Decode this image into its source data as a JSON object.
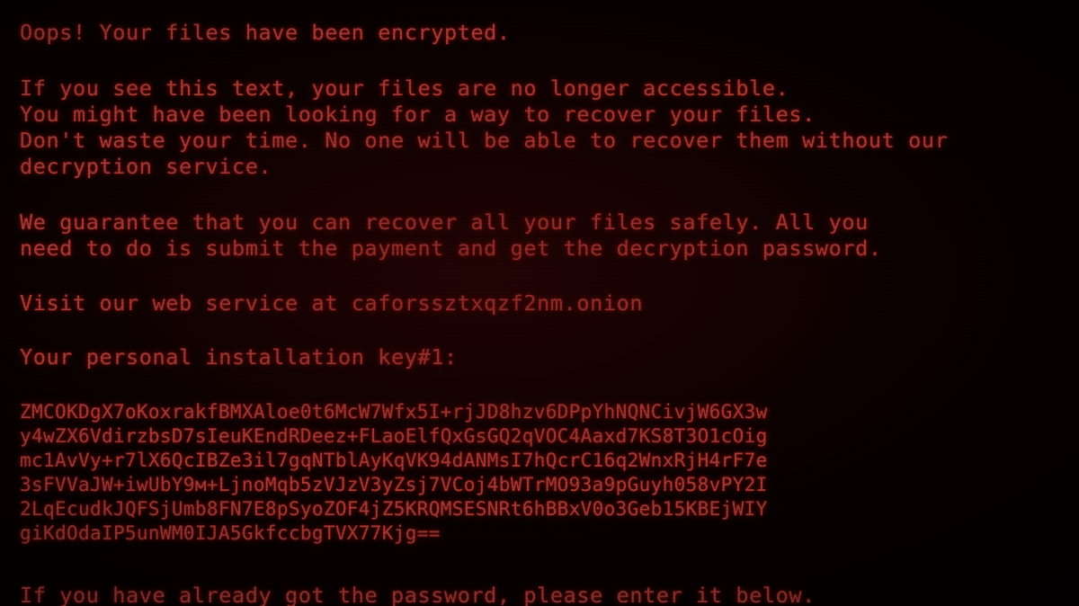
{
  "screen": {
    "kind": "ransomware-lock-screen",
    "background_color": "#000000",
    "text_color": "#e8564e",
    "glow_color": "#b81f18"
  },
  "message": {
    "headline": "Oops! Your files have been encrypted.",
    "paragraph1": [
      "If you see this text, your files are no longer accessible.",
      "You might have been looking for a way to recover your files.",
      "Don't waste your time. No one will be able to recover them without our",
      "decryption service."
    ],
    "paragraph2": [
      "We guarantee that you can recover all your files safely. All you",
      "need to do is submit the payment and get the decryption password."
    ],
    "web_service_line": "Visit our web service at caforssztxqzf2nm.onion",
    "key_label": "Your personal installation key#1:",
    "key_lines": [
      "ZMCOKDgX7oKoxrakfBMXAloe0t6McW7Wfx5I+rjJD8hzv6DPpYhNQNCivjW6GX3w",
      "y4wZX6VdirzbsD7sIeuKEndRDeez+FLaoElfQxGsGQ2qVOC4Aaxd7KS8T3O1cOig",
      "mc1AvVy+r7lX6QcIBZe3il7gqNTblAyKqVK94dANMsI7hQcrC16q2WnxRjH4rF7e",
      "3sFVVaJW+iwUbY9м+LjnoMqb5zVJzV3yZsj7VCoj4bWTrMO93a9pGuyh058vPY2I",
      "2LqEcudkJQFSjUmb8FN7E8pSyoZOF4jZ5KRQMSESNRt6hBBxV0o3Geb15KBEjWIY",
      "giKdOdaIP5unWM0IJA5GkfccbgTVX77Kjg=="
    ],
    "password_prompt": "If you have already got the password, please enter it below."
  }
}
